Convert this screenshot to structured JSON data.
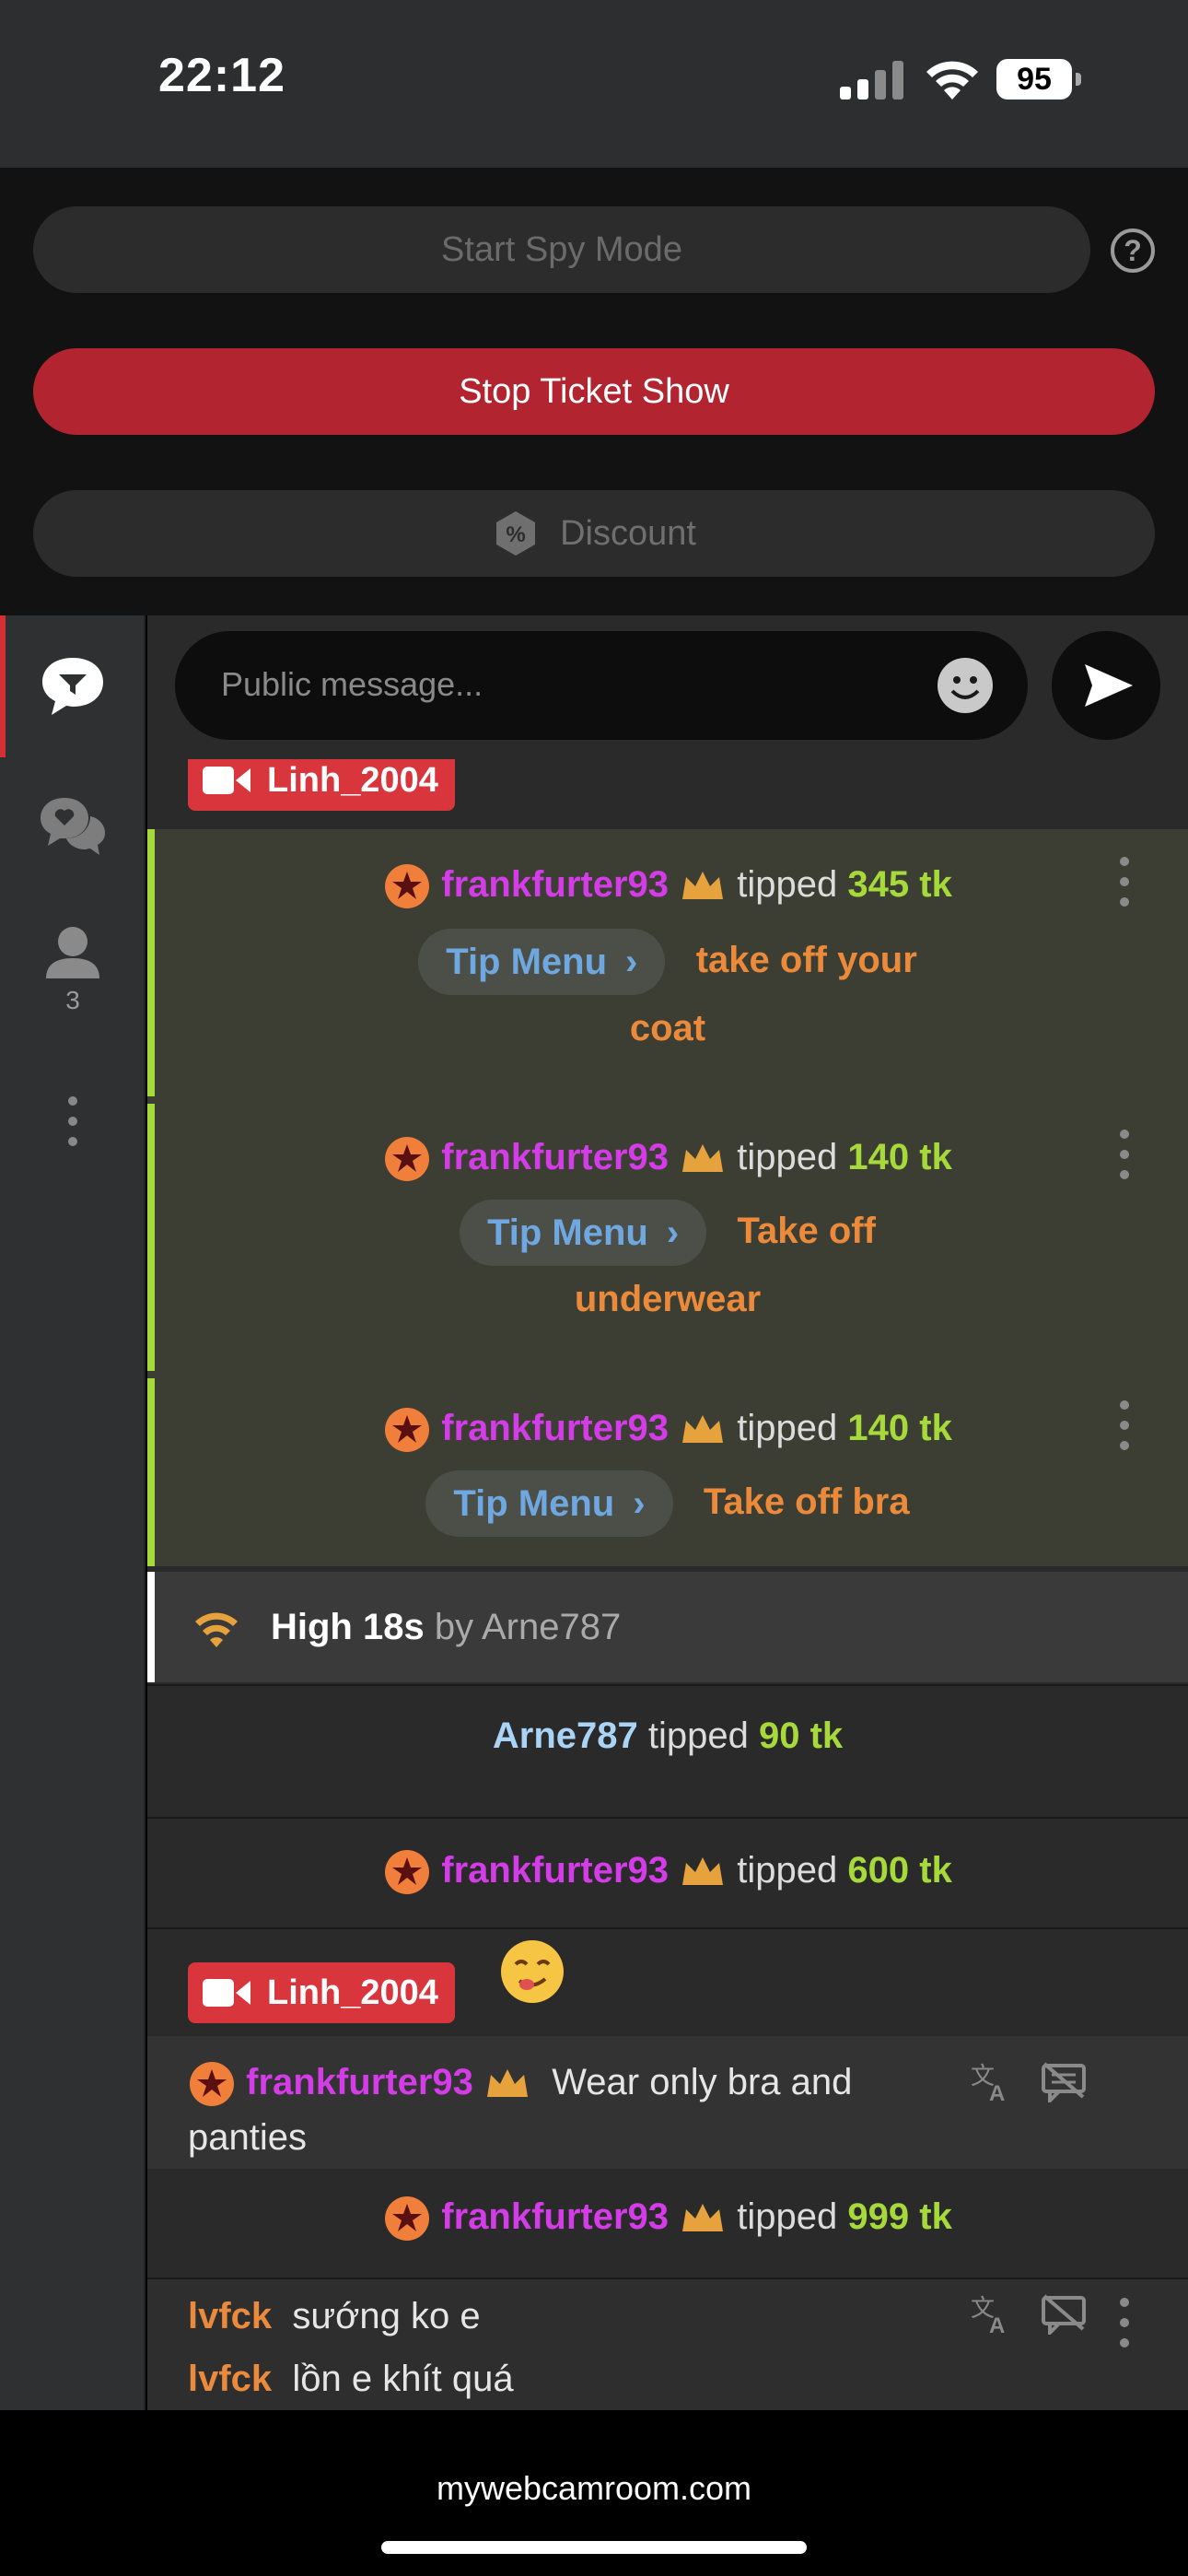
{
  "status_bar": {
    "time": "22:12",
    "battery": "95",
    "icons": [
      "cellular-signal-icon",
      "wifi-icon",
      "battery-icon"
    ]
  },
  "controls": {
    "spy_mode_label": "Start Spy Mode",
    "help_label": "?",
    "stop_ticket_label": "Stop Ticket Show",
    "discount_label": "Discount",
    "discount_icon": "%"
  },
  "sidebar": {
    "items": [
      {
        "name": "public-chat-icon",
        "active": true
      },
      {
        "name": "private-chat-icon",
        "active": false
      },
      {
        "name": "users-icon",
        "count": "3"
      },
      {
        "name": "more-icon"
      }
    ]
  },
  "input": {
    "placeholder": "Public message..."
  },
  "chat": {
    "partial_top_model": "Linh_2004",
    "tip_group": [
      {
        "user": "frankfurter93",
        "tipped_word": "tipped",
        "amount": "345 tk",
        "menu_label": "Tip Menu",
        "action_line1": "take off your",
        "action_line2": "coat"
      },
      {
        "user": "frankfurter93",
        "tipped_word": "tipped",
        "amount": "140 tk",
        "menu_label": "Tip Menu",
        "action_line1": "Take off",
        "action_line2": "underwear"
      },
      {
        "user": "frankfurter93",
        "tipped_word": "tipped",
        "amount": "140 tk",
        "menu_label": "Tip Menu",
        "action_line1": "Take off bra",
        "action_line2": ""
      }
    ],
    "goal": {
      "title": "High 18s",
      "by": "by",
      "user": "Arne787"
    },
    "tips": [
      {
        "user": "Arne787",
        "tipped_word": "tipped",
        "amount": "90 tk"
      },
      {
        "user": "frankfurter93",
        "tipped_word": "tipped",
        "amount": "600 tk"
      }
    ],
    "model_badge": "Linh_2004",
    "message1": {
      "user": "frankfurter93",
      "text_line1": "Wear only bra and",
      "text_line2": "panties"
    },
    "tip_after": {
      "user": "frankfurter93",
      "tipped_word": "tipped",
      "amount": "999 tk"
    },
    "lv_messages": [
      {
        "user": "lvfck",
        "text": "sướng ko e"
      },
      {
        "user": "lvfck",
        "text": "lồn e khít quá"
      }
    ]
  },
  "browser": {
    "domain": "mywebcamroom.com"
  },
  "colors": {
    "accent_red": "#b22530",
    "tip_green": "#a6d93a",
    "username_pink": "#d33ce6",
    "tip_action_orange": "#eb8a3a",
    "tip_menu_blue": "#6fa8e0"
  }
}
